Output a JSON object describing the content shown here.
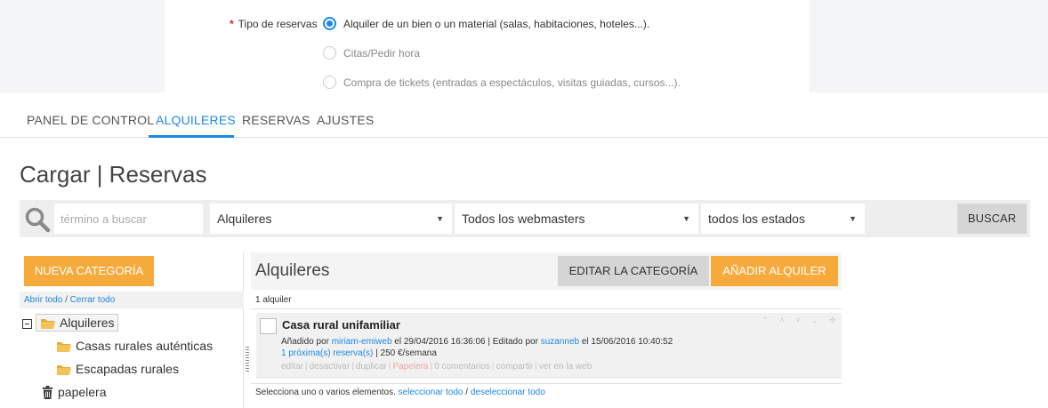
{
  "form": {
    "required_mark": "*",
    "label": "Tipo de reservas",
    "options": [
      {
        "label": "Alquiler de un bien o un material (salas, habitaciones, hoteles...).",
        "selected": true
      },
      {
        "label": "Citas/Pedir hora",
        "selected": false
      },
      {
        "label": "Compra de tickets (entradas a espectáculos, visitas guiadas, cursos...).",
        "selected": false
      }
    ]
  },
  "tabs": [
    {
      "label": "PANEL DE CONTROL",
      "active": false
    },
    {
      "label": "ALQUILERES",
      "active": true
    },
    {
      "label": "RESERVAS",
      "active": false
    },
    {
      "label": "AJUSTES",
      "active": false
    }
  ],
  "page_title": "Cargar | Reservas",
  "filters": {
    "search_placeholder": "término a buscar",
    "category": "Alquileres",
    "webmaster": "Todos los webmasters",
    "status": "todos los estados",
    "search_button": "BUSCAR"
  },
  "left": {
    "new_category_button": "NUEVA CATEGORÍA",
    "open_all": "Abrir todo",
    "link_separator": "/",
    "close_all": "Cerrar todo",
    "tree": {
      "root": "Alquileres",
      "children": [
        "Casas rurales auténticas",
        "Escapadas rurales"
      ],
      "trash": "papelera"
    }
  },
  "right": {
    "title": "Alquileres",
    "edit_button": "EDITAR LA CATEGORÍA",
    "add_button": "AÑADIR ALQUILER",
    "count": "1 alquiler",
    "item": {
      "title": "Casa rural unifamiliar",
      "added_prefix": "Añadido por",
      "added_by": "miriam-emiweb",
      "added_on": "el 29/04/2016 16:36:06 | Editado por",
      "edited_by": "suzanneb",
      "edited_on": "el 15/06/2016 10:40:52",
      "upcoming": "1 próxima(s) reserva(s)",
      "price": "| 250 €/semana",
      "actions": [
        {
          "label": "editar",
          "danger": false
        },
        {
          "label": "desactivar",
          "danger": false
        },
        {
          "label": "duplicar",
          "danger": false
        },
        {
          "label": "Papelera",
          "danger": true
        },
        {
          "label": "0 comentarios",
          "danger": false
        },
        {
          "label": "compartir",
          "danger": false
        },
        {
          "label": "ver en la web",
          "danger": false
        }
      ]
    },
    "footer": {
      "text": "Selecciona uno o varios elementos.",
      "select_all": "seleccionar todo",
      "separator": "/",
      "deselect_all": "deseleccionar todo"
    }
  },
  "colors": {
    "accent": "#1e88e5",
    "orange": "#f7aa3c",
    "required": "#d9232d"
  }
}
